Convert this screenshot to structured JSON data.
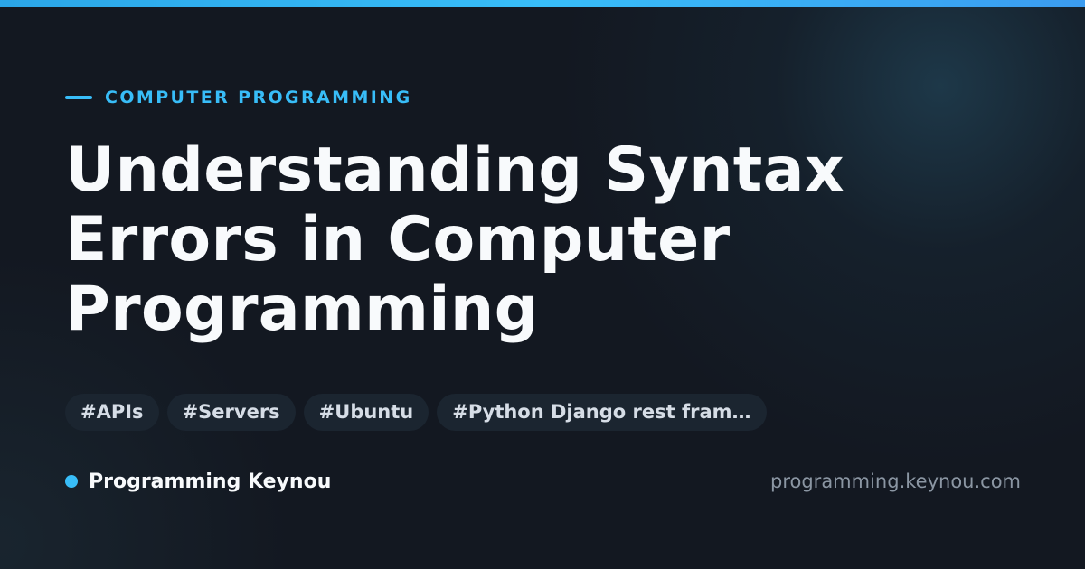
{
  "colors": {
    "accent": "#38bdf8",
    "background": "#131821",
    "title": "#f8fafc",
    "tag_background": "#1b2530",
    "tag_text": "#d6dde6",
    "muted": "#8b96a3"
  },
  "category": "COMPUTER PROGRAMMING",
  "title_lines": [
    "Understanding Syntax",
    "Errors in Computer",
    "Programming"
  ],
  "tags": [
    "#APIs",
    "#Servers",
    "#Ubuntu",
    "#Python Django rest fram…"
  ],
  "brand": {
    "name": "Programming Keynou",
    "url": "programming.keynou.com"
  }
}
